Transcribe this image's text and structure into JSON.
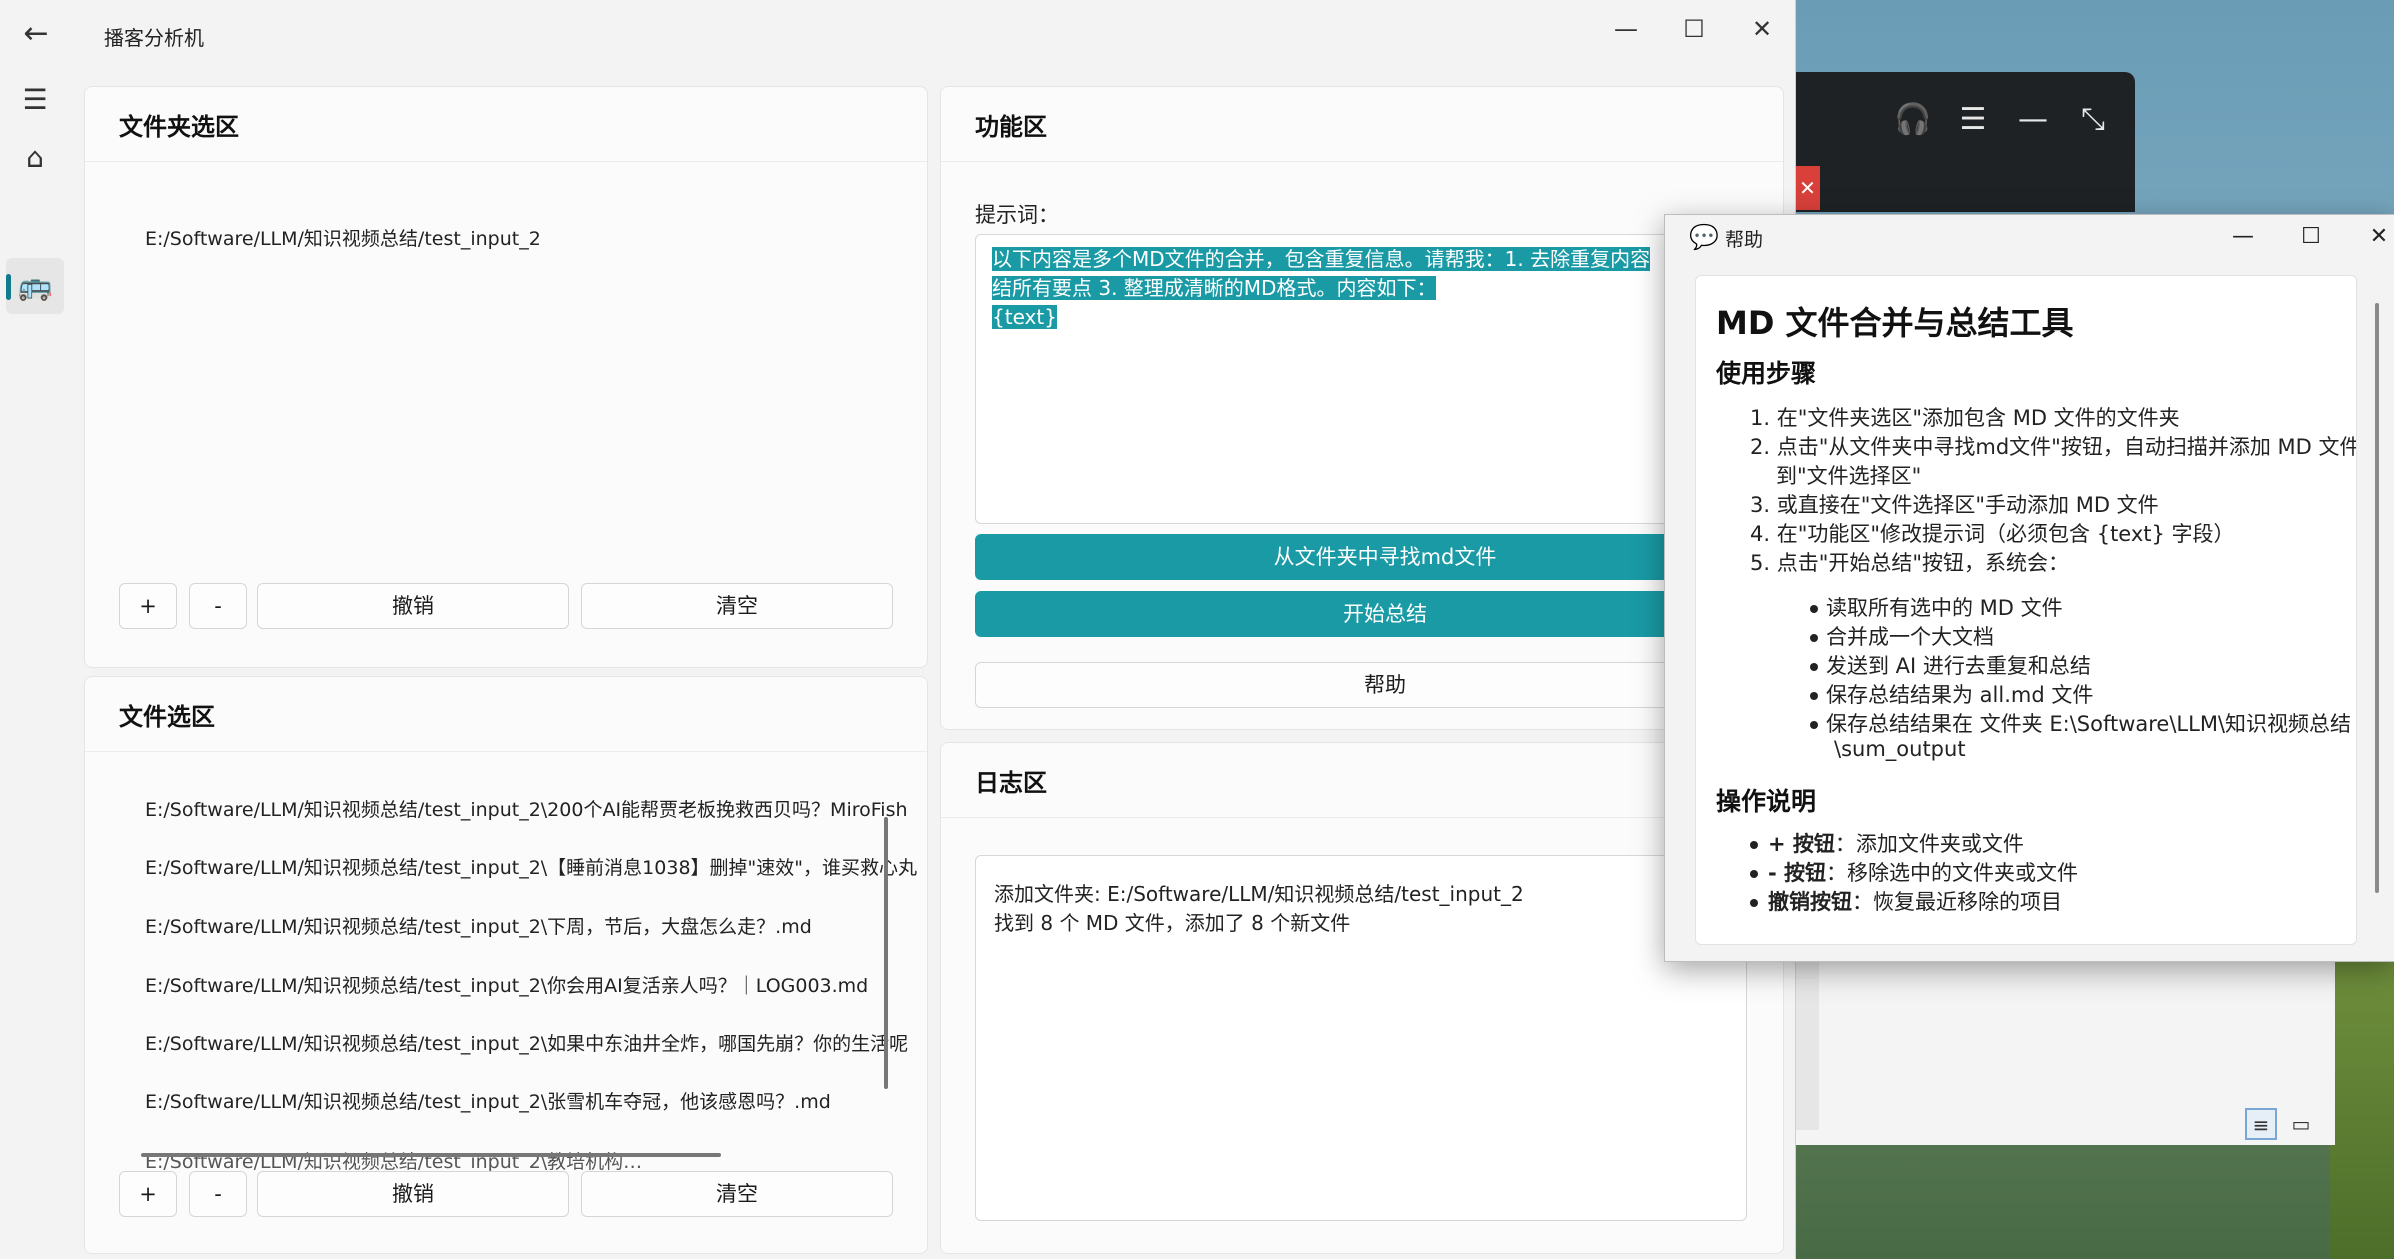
{
  "app": {
    "title": "播客分析机",
    "back_icon": "arrow-left-icon",
    "minimize_glyph": "—",
    "maximize_glyph": "☐",
    "close_glyph": "✕"
  },
  "nav": {
    "items": [
      {
        "name": "menu-icon",
        "glyph": "☰"
      },
      {
        "name": "home-icon",
        "glyph": "⌂"
      },
      {
        "name": "bus-icon",
        "glyph": "🚌"
      }
    ]
  },
  "folder_card": {
    "title": "文件夹选区",
    "path": "E:/Software/LLM/知识视频总结/test_input_2",
    "btn_add": "+",
    "btn_remove": "-",
    "btn_undo": "撤销",
    "btn_clear": "清空"
  },
  "file_card": {
    "title": "文件选区",
    "files": [
      "E:/Software/LLM/知识视频总结/test_input_2\\200个AI能帮贾老板挽救西贝吗？MiroFish",
      "E:/Software/LLM/知识视频总结/test_input_2\\【睡前消息1038】删掉\"速效\"，谁买救心丸",
      "E:/Software/LLM/知识视频总结/test_input_2\\下周，节后，大盘怎么走？.md",
      "E:/Software/LLM/知识视频总结/test_input_2\\你会用AI复活亲人吗？｜LOG003.md",
      "E:/Software/LLM/知识视频总结/test_input_2\\如果中东油井全炸，哪国先崩？你的生活呢",
      "E:/Software/LLM/知识视频总结/test_input_2\\张雪机车夺冠，他该感恩吗？.md",
      "E:/Software/LLM/知识视频总结/test_input_2\\教培机构…"
    ],
    "btn_add": "+",
    "btn_remove": "-",
    "btn_undo": "撤销",
    "btn_clear": "清空"
  },
  "function_card": {
    "title": "功能区",
    "prompt_label": "提示词：",
    "prompt_lines": [
      "以下内容是多个MD文件的合并，包含重复信息。请帮我：1. 去除重复内容",
      "结所有要点 3. 整理成清晰的MD格式。内容如下：",
      "{text}"
    ],
    "btn_find": "从文件夹中寻找md文件",
    "btn_start": "开始总结",
    "btn_help": "帮助"
  },
  "log_card": {
    "title": "日志区",
    "lines": [
      "添加文件夹: E:/Software/LLM/知识视频总结/test_input_2",
      "找到 8 个 MD 文件，添加了 8 个新文件"
    ]
  },
  "help_window": {
    "title": "帮助",
    "heading": "MD 文件合并与总结工具",
    "section1": "使用步骤",
    "steps": [
      "1. 在\"文件夹选区\"添加包含 MD 文件的文件夹",
      "2. 点击\"从文件夹中寻找md文件\"按钮，自动扫描并添加 MD 文件",
      "到\"文件选择区\"",
      "3. 或直接在\"文件选择区\"手动添加 MD 文件",
      "4. 在\"功能区\"修改提示词（必须包含 {text} 字段）",
      "5. 点击\"开始总结\"按钮，系统会："
    ],
    "substeps": [
      "读取所有选中的 MD 文件",
      "合并成一个大文档",
      "发送到 AI 进行去重复和总结",
      "保存总结结果为 all.md 文件",
      "保存总结结果在 文件夹 E:\\Software\\LLM\\知识视频总结",
      "\\sum_output"
    ],
    "section2": "操作说明",
    "ops": [
      {
        "key": "+ 按钮",
        "desc": "：添加文件夹或文件"
      },
      {
        "key": "- 按钮",
        "desc": "：移除选中的文件夹或文件"
      },
      {
        "key": "撤销按钮",
        "desc": "：恢复最近移除的项目"
      }
    ]
  },
  "background_window": {
    "icons": [
      "headset-icon",
      "list-add-icon",
      "minimize-icon",
      "collapse-icon"
    ]
  },
  "colors": {
    "accent": "#1a9aa5",
    "nav_indicator": "#0f7b8c"
  }
}
